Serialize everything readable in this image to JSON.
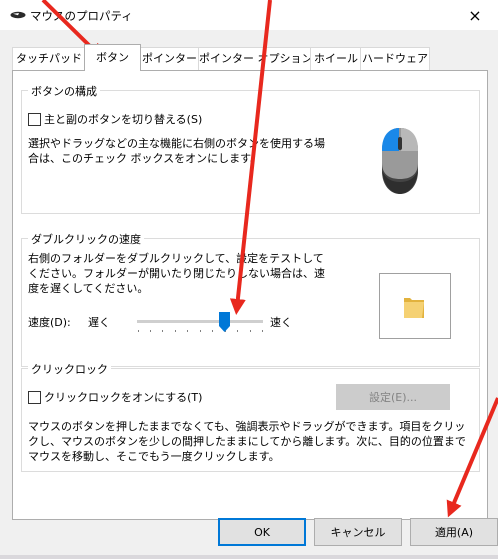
{
  "window": {
    "title": "マウスのプロパティ",
    "close_symbol": "×"
  },
  "tabs": [
    {
      "label": "タッチパッド"
    },
    {
      "label": "ボタン"
    },
    {
      "label": "ポインター"
    },
    {
      "label": "ポインター オプション"
    },
    {
      "label": "ホイール"
    },
    {
      "label": "ハードウェア"
    }
  ],
  "button_config": {
    "title": "ボタンの構成",
    "checkbox_label": "主と副のボタンを切り替える(S)",
    "checked": false,
    "description": "選択やドラッグなどの主な機能に右側のボタンを使用する場合は、このチェック ボックスをオンにします。"
  },
  "double_click": {
    "title": "ダブルクリックの速度",
    "description": "右側のフォルダーをダブルクリックして、設定をテストしてください。フォルダーが開いたり閉じたりしない場合は、速度を遅くしてください。",
    "speed_label": "速度(D):",
    "slow_label": "遅く",
    "fast_label": "速く",
    "slider_value": 0.7
  },
  "click_lock": {
    "title": "クリックロック",
    "checkbox_label": "クリックロックをオンにする(T)",
    "checked": false,
    "settings_button": "設定(E)...",
    "description": "マウスのボタンを押したままでなくても、強調表示やドラッグができます。項目をクリックし、マウスのボタンを少しの間押したままにしてから離します。次に、目的の位置までマウスを移動し、そこでもう一度クリックします。"
  },
  "footer": {
    "ok": "OK",
    "cancel": "キャンセル",
    "apply": "適用(A)"
  },
  "colors": {
    "accent": "#0078d7",
    "annotation_arrow": "#e8281e",
    "folder": "#f5d173"
  },
  "icons": [
    "mouse-settings-icon",
    "close-icon",
    "mouse-image",
    "folder-icon",
    "slider-thumb"
  ]
}
